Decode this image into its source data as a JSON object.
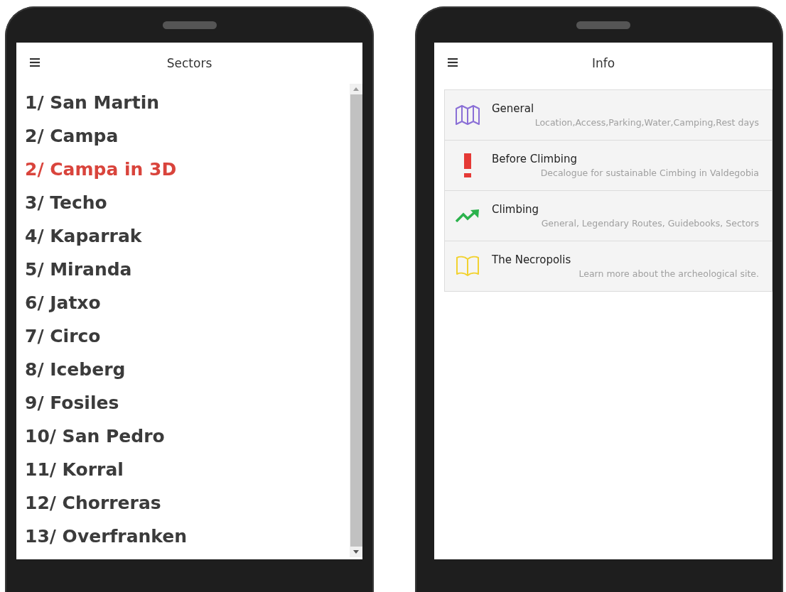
{
  "sectors_screen": {
    "title": "Sectors",
    "items": [
      {
        "label": "1/ San Martin",
        "selected": false
      },
      {
        "label": "2/ Campa",
        "selected": false
      },
      {
        "label": "2/ Campa in 3D",
        "selected": true
      },
      {
        "label": "3/ Techo",
        "selected": false
      },
      {
        "label": "4/ Kaparrak",
        "selected": false
      },
      {
        "label": "5/ Miranda",
        "selected": false
      },
      {
        "label": "6/ Jatxo",
        "selected": false
      },
      {
        "label": "7/ Circo",
        "selected": false
      },
      {
        "label": "8/ Iceberg",
        "selected": false
      },
      {
        "label": "9/ Fosiles",
        "selected": false
      },
      {
        "label": "10/ San Pedro",
        "selected": false
      },
      {
        "label": "11/ Korral",
        "selected": false
      },
      {
        "label": "12/ Chorreras",
        "selected": false
      },
      {
        "label": "13/ Overfranken",
        "selected": false
      }
    ]
  },
  "info_screen": {
    "title": "Info",
    "items": [
      {
        "kind": "map",
        "color": "#8a6fd6",
        "title": "General",
        "subtitle": "Location,Access,Parking,Water,Camping,Rest days"
      },
      {
        "kind": "alert",
        "color": "#e53935",
        "title": "Before Climbing",
        "subtitle": "Decalogue for sustainable Cimbing in Valdegobia"
      },
      {
        "kind": "trend",
        "color": "#2bb24c",
        "title": "Climbing",
        "subtitle": "General, Legendary Routes, Guidebooks, Sectors"
      },
      {
        "kind": "book",
        "color": "#f2d230",
        "title": "The Necropolis",
        "subtitle": "Learn more about the archeological site."
      }
    ]
  }
}
